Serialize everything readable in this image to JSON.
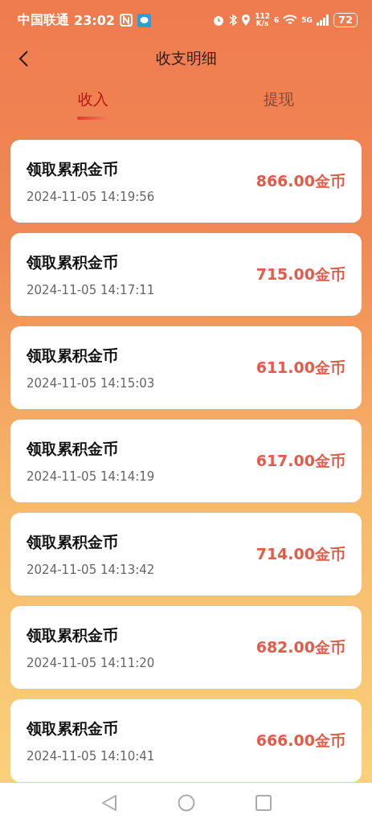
{
  "status_bar": {
    "carrier": "中国联通",
    "time": "23:02",
    "speed_value": "112",
    "speed_unit": "K/s",
    "wifi_label": "6",
    "network": "5G",
    "battery": "72"
  },
  "header": {
    "title": "收支明细"
  },
  "tabs": [
    {
      "label": "收入",
      "selected": true
    },
    {
      "label": "提现",
      "selected": false
    }
  ],
  "records": [
    {
      "title": "领取累积金币",
      "time": "2024-11-05 14:19:56",
      "amount": "866.00金币"
    },
    {
      "title": "领取累积金币",
      "time": "2024-11-05 14:17:11",
      "amount": "715.00金币"
    },
    {
      "title": "领取累积金币",
      "time": "2024-11-05 14:15:03",
      "amount": "611.00金币"
    },
    {
      "title": "领取累积金币",
      "time": "2024-11-05 14:14:19",
      "amount": "617.00金币"
    },
    {
      "title": "领取累积金币",
      "time": "2024-11-05 14:13:42",
      "amount": "714.00金币"
    },
    {
      "title": "领取累积金币",
      "time": "2024-11-05 14:11:20",
      "amount": "682.00金币"
    },
    {
      "title": "领取累积金币",
      "time": "2024-11-05 14:10:41",
      "amount": "666.00金币"
    }
  ]
}
